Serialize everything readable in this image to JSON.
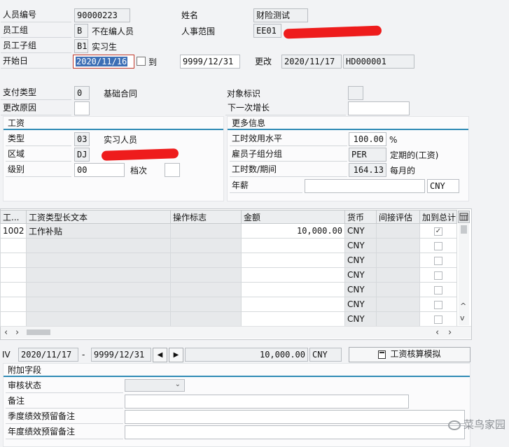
{
  "header": {
    "pernr_label": "人员编号",
    "pernr_value": "90000223",
    "name_label": "姓名",
    "name_value": "财险测试",
    "eg_label": "员工组",
    "eg_value": "B",
    "eg_text": "不在编人员",
    "pa_label": "人事范围",
    "pa_value": "EE01",
    "esg_label": "员工子组",
    "esg_value": "B1",
    "esg_text": "实习生",
    "begin_label": "开始日",
    "begin_value": "2020/11/16",
    "to_label": "到",
    "end_value": "9999/12/31",
    "changed_label": "更改",
    "changed_date": "2020/11/17",
    "changed_by": "HD000001"
  },
  "basic": {
    "pay_type_label": "支付类型",
    "pay_type_value": "0",
    "pay_type_text": "基础合同",
    "object_flag_label": "对象标识",
    "reason_label": "更改原因",
    "next_increase_label": "下一次增长"
  },
  "salary": {
    "title": "工资",
    "type_label": "类型",
    "type_value": "03",
    "type_text": "实习人员",
    "area_label": "区域",
    "area_value": "DJ",
    "level_label": "级别",
    "level_value": "00",
    "grade_label": "档次"
  },
  "more": {
    "title": "更多信息",
    "capacity_label": "工时效用水平",
    "capacity_value": "100.00",
    "capacity_unit": "%",
    "esg_group_label": "雇员子组分组",
    "esg_group_value": "PER",
    "esg_group_text": "定期的(工资)",
    "hours_label": "工时数/期间",
    "hours_value": "164.13",
    "hours_unit": "每月的",
    "annual_label": "年薪",
    "annual_currency": "CNY"
  },
  "table": {
    "columns": [
      "工...",
      "工资类型长文本",
      "操作标志",
      "金额",
      "货币",
      "间接评估",
      "加到总计"
    ],
    "rows": [
      {
        "wt": "1002",
        "text": "工作补贴",
        "op": "",
        "amount": "10,000.00",
        "cur": "CNY",
        "indirect": "",
        "total": "✓"
      },
      {
        "wt": "",
        "text": "",
        "op": "",
        "amount": "",
        "cur": "CNY",
        "indirect": "",
        "total": ""
      },
      {
        "wt": "",
        "text": "",
        "op": "",
        "amount": "",
        "cur": "CNY",
        "indirect": "",
        "total": ""
      },
      {
        "wt": "",
        "text": "",
        "op": "",
        "amount": "",
        "cur": "CNY",
        "indirect": "",
        "total": ""
      },
      {
        "wt": "",
        "text": "",
        "op": "",
        "amount": "",
        "cur": "CNY",
        "indirect": "",
        "total": ""
      },
      {
        "wt": "",
        "text": "",
        "op": "",
        "amount": "",
        "cur": "CNY",
        "indirect": "",
        "total": ""
      },
      {
        "wt": "",
        "text": "",
        "op": "",
        "amount": "",
        "cur": "CNY",
        "indirect": "",
        "total": ""
      }
    ]
  },
  "totals": {
    "iv_label": "IV",
    "from": "2020/11/17",
    "dash": "-",
    "to": "9999/12/31",
    "amount": "10,000.00",
    "currency": "CNY",
    "simulate_button": "工资核算模拟"
  },
  "extra": {
    "title": "附加字段",
    "review_label": "审核状态",
    "remark_label": "备注",
    "quarter_label": "季度绩效预留备注",
    "annual_label": "年度绩效预留备注"
  },
  "watermark": {
    "text": "菜鸟家园"
  },
  "colors": {
    "accent": "#2f8bb5",
    "selection": "#3d6fb5",
    "redaction": "#ee1c1c"
  }
}
